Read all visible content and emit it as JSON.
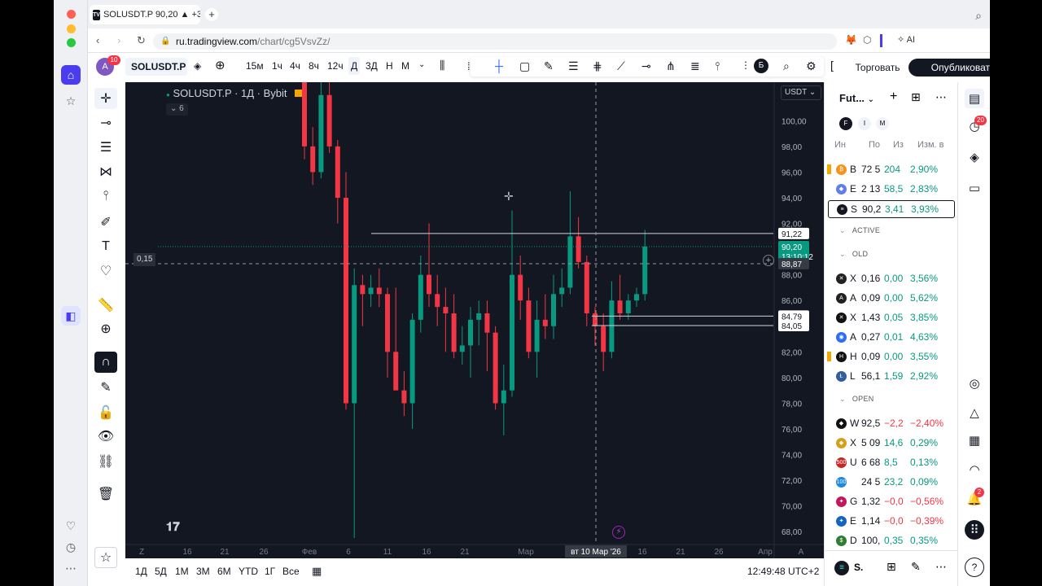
{
  "browser": {
    "tab_title": "SOLUSDT.P 90,20 ▲ +3",
    "url_host": "ru.tradingview.com",
    "url_path": "/chart/cg5VsvZz/",
    "ai_label": "AI"
  },
  "toolbar": {
    "notif_count": "10",
    "symbol": "SOLUSDT.P",
    "intervals": [
      "15м",
      "1ч",
      "4ч",
      "8ч",
      "12ч",
      "Д",
      "3Д",
      "Н",
      "М"
    ],
    "badge_b": "Б",
    "trade_label": "Торговать",
    "publish_label": "Опубликовать"
  },
  "chart": {
    "legend_title": "SOLUSDT.P · 1Д · Bybit",
    "indicators_count": "6",
    "currency": "USDT",
    "cursor_value": "0,15",
    "cursor_date": "вт 10 Мар '26",
    "price_labels": {
      "line_upper": "91,22",
      "last_price": "90,20",
      "countdown": "13:10:12",
      "cursor_price": "88,87",
      "line_mid": "84,79",
      "line_low": "84,05"
    },
    "x_ticks": [
      "16",
      "21",
      "26",
      "Фев",
      "6",
      "11",
      "16",
      "21",
      "Мар",
      "16",
      "21",
      "26",
      "Апр"
    ],
    "corner_z": "Z",
    "corner_a": "A"
  },
  "chart_data": {
    "type": "candlestick",
    "title": "SOLUSDT.P · 1Д · Bybit",
    "ylim": [
      67,
      103
    ],
    "y_ticks": [
      68,
      70,
      72,
      74,
      76,
      78,
      80,
      82,
      84,
      86,
      88,
      90,
      92,
      94,
      96,
      98,
      100
    ],
    "y_tick_labels": [
      "68,00",
      "70,00",
      "72,00",
      "74,00",
      "76,00",
      "78,00",
      "80,00",
      "82,00",
      "84,00",
      "86,00",
      "88,00",
      "90,00",
      "92,00",
      "94,00",
      "96,00",
      "98,00",
      "100,00"
    ],
    "horizontal_lines": [
      91.22,
      84.79,
      84.05
    ],
    "last_price": 90.2,
    "candles": [
      {
        "o": 104.0,
        "h": 104.0,
        "l": 97.0,
        "c": 98.0
      },
      {
        "o": 98.0,
        "h": 99.5,
        "l": 95.0,
        "c": 96.0
      },
      {
        "o": 96.0,
        "h": 103.0,
        "l": 95.5,
        "c": 102.0
      },
      {
        "o": 102.0,
        "h": 103.0,
        "l": 97.5,
        "c": 98.0
      },
      {
        "o": 98.0,
        "h": 98.5,
        "l": 92.0,
        "c": 94.0
      },
      {
        "o": 94.0,
        "h": 96.0,
        "l": 77.5,
        "c": 78.0
      },
      {
        "o": 78.0,
        "h": 88.5,
        "l": 67.5,
        "c": 87.2
      },
      {
        "o": 87.2,
        "h": 88.0,
        "l": 84.0,
        "c": 86.5
      },
      {
        "o": 86.5,
        "h": 88.0,
        "l": 85.5,
        "c": 87.0
      },
      {
        "o": 87.0,
        "h": 88.5,
        "l": 85.5,
        "c": 86.5
      },
      {
        "o": 86.5,
        "h": 87.0,
        "l": 80.0,
        "c": 82.0
      },
      {
        "o": 82.0,
        "h": 87.0,
        "l": 79.5,
        "c": 79.0
      },
      {
        "o": 79.0,
        "h": 80.5,
        "l": 77.0,
        "c": 78.0
      },
      {
        "o": 78.0,
        "h": 85.0,
        "l": 76.0,
        "c": 84.5
      },
      {
        "o": 84.5,
        "h": 89.5,
        "l": 83.5,
        "c": 88.0
      },
      {
        "o": 88.0,
        "h": 92.0,
        "l": 85.5,
        "c": 86.5
      },
      {
        "o": 86.5,
        "h": 88.0,
        "l": 84.0,
        "c": 85.5
      },
      {
        "o": 85.5,
        "h": 87.0,
        "l": 82.0,
        "c": 85.0
      },
      {
        "o": 85.0,
        "h": 86.5,
        "l": 81.5,
        "c": 82.0
      },
      {
        "o": 82.0,
        "h": 84.0,
        "l": 81.0,
        "c": 82.5
      },
      {
        "o": 82.5,
        "h": 85.5,
        "l": 80.0,
        "c": 84.5
      },
      {
        "o": 84.5,
        "h": 86.0,
        "l": 82.5,
        "c": 85.0
      },
      {
        "o": 85.0,
        "h": 86.0,
        "l": 80.5,
        "c": 83.5
      },
      {
        "o": 83.5,
        "h": 84.0,
        "l": 77.5,
        "c": 78.0
      },
      {
        "o": 78.0,
        "h": 81.0,
        "l": 75.5,
        "c": 79.0
      },
      {
        "o": 79.0,
        "h": 93.0,
        "l": 78.5,
        "c": 88.0
      },
      {
        "o": 88.0,
        "h": 89.5,
        "l": 84.5,
        "c": 86.0
      },
      {
        "o": 86.0,
        "h": 87.0,
        "l": 81.5,
        "c": 82.0
      },
      {
        "o": 82.0,
        "h": 86.0,
        "l": 80.0,
        "c": 84.5
      },
      {
        "o": 84.5,
        "h": 86.5,
        "l": 83.0,
        "c": 84.0
      },
      {
        "o": 84.0,
        "h": 88.0,
        "l": 83.0,
        "c": 86.5
      },
      {
        "o": 86.5,
        "h": 88.5,
        "l": 85.5,
        "c": 87.0
      },
      {
        "o": 87.0,
        "h": 94.5,
        "l": 86.5,
        "c": 91.0
      },
      {
        "o": 91.0,
        "h": 92.5,
        "l": 88.5,
        "c": 89.0
      },
      {
        "o": 89.0,
        "h": 89.5,
        "l": 84.0,
        "c": 85.0
      },
      {
        "o": 85.0,
        "h": 85.5,
        "l": 82.5,
        "c": 84.0
      },
      {
        "o": 84.0,
        "h": 85.0,
        "l": 80.5,
        "c": 82.0
      },
      {
        "o": 82.0,
        "h": 87.5,
        "l": 81.5,
        "c": 86.0
      },
      {
        "o": 86.0,
        "h": 88.0,
        "l": 84.5,
        "c": 85.0
      },
      {
        "o": 85.0,
        "h": 86.5,
        "l": 84.5,
        "c": 86.0
      },
      {
        "o": 86.0,
        "h": 87.0,
        "l": 85.5,
        "c": 86.5
      },
      {
        "o": 86.5,
        "h": 91.5,
        "l": 86.0,
        "c": 90.2
      }
    ]
  },
  "bottom": {
    "ranges": [
      "1Д",
      "5Д",
      "1М",
      "3М",
      "6М",
      "YTD",
      "1Г",
      "Все"
    ],
    "clock": "12:49:48 UTC+2"
  },
  "watchlist": {
    "title": "Fut...",
    "filters": [
      "F",
      "I",
      "M"
    ],
    "columns": [
      "Ин",
      "По",
      "Из",
      "Изм. в"
    ],
    "top": [
      {
        "sym": "B",
        "last": "72 5",
        "chg": "204",
        "pct": "2,90%",
        "color": "#f7931a",
        "glyph": "₿",
        "dir": "up",
        "flag": true
      },
      {
        "sym": "E",
        "last": "2 13",
        "chg": "58,5",
        "pct": "2,83%",
        "color": "#627eea",
        "glyph": "◆",
        "dir": "up",
        "flag": false
      },
      {
        "sym": "S",
        "last": "90,2",
        "chg": "3,41",
        "pct": "3,93%",
        "color": "#131722",
        "glyph": "≡",
        "dir": "up",
        "flag": false
      }
    ],
    "sections": [
      {
        "name": "ACTIVE",
        "rows": []
      },
      {
        "name": "OLD",
        "rows": [
          {
            "sym": "X",
            "last": "0,16",
            "chg": "0,00",
            "pct": "3,56%",
            "color": "#222",
            "glyph": "✕",
            "dir": "up",
            "flag": false
          },
          {
            "sym": "A",
            "last": "0,09",
            "chg": "0,00",
            "pct": "5,62%",
            "color": "#222",
            "glyph": "A",
            "dir": "up",
            "flag": false
          },
          {
            "sym": "X",
            "last": "1,43",
            "chg": "0,05",
            "pct": "3,85%",
            "color": "#111",
            "glyph": "✕",
            "dir": "up",
            "flag": false
          },
          {
            "sym": "A",
            "last": "0,27",
            "chg": "0,01",
            "pct": "4,63%",
            "color": "#2d6cf6",
            "glyph": "◉",
            "dir": "up",
            "flag": false
          },
          {
            "sym": "H",
            "last": "0,09",
            "chg": "0,00",
            "pct": "3,55%",
            "color": "#111",
            "glyph": "H",
            "dir": "up",
            "flag": true
          },
          {
            "sym": "L",
            "last": "56,1",
            "chg": "1,59",
            "pct": "2,92%",
            "color": "#345d9d",
            "glyph": "Ł",
            "dir": "up",
            "flag": false
          }
        ]
      },
      {
        "name": "OPEN",
        "rows": [
          {
            "sym": "W",
            "last": "92,5",
            "chg": "−2,2",
            "pct": "−2,40%",
            "color": "#111",
            "glyph": "◆",
            "dir": "dn",
            "flag": false
          },
          {
            "sym": "X",
            "last": "5 09",
            "chg": "14,6",
            "pct": "0,29%",
            "color": "#d4a017",
            "glyph": "◆",
            "dir": "up",
            "flag": false
          },
          {
            "sym": "U",
            "last": "6 68",
            "chg": "8,5",
            "pct": "0,13%",
            "color": "#c62828",
            "glyph": "500",
            "dir": "up",
            "flag": false
          },
          {
            "sym": "",
            "last": "24 5",
            "chg": "23,2",
            "pct": "0,09%",
            "color": "#1e88e5",
            "glyph": "100",
            "dir": "up",
            "flag": false
          },
          {
            "sym": "G",
            "last": "1,32",
            "chg": "−0,0",
            "pct": "−0,56%",
            "color": "#c2185b",
            "glyph": "✦",
            "dir": "dn",
            "flag": false
          },
          {
            "sym": "E",
            "last": "1,14",
            "chg": "−0,0",
            "pct": "−0,39%",
            "color": "#1565c0",
            "glyph": "✦",
            "dir": "dn",
            "flag": false
          },
          {
            "sym": "D",
            "last": "100,",
            "chg": "0,35",
            "pct": "0,35%",
            "color": "#2e7d32",
            "glyph": "$",
            "dir": "up",
            "flag": false
          }
        ]
      }
    ],
    "footer_symbol": "S."
  },
  "rightstrip": {
    "alerts_count": "20",
    "notif_count": "2"
  },
  "colors": {
    "up": "#089981",
    "down": "#f23645",
    "chart_bg": "#131722",
    "accent": "#2962ff"
  }
}
